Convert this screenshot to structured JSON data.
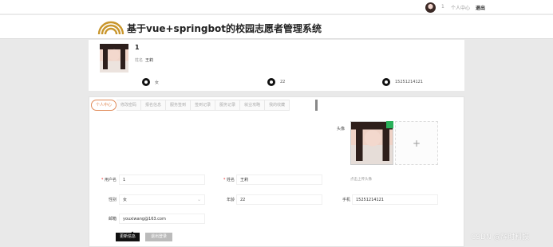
{
  "topbar": {
    "username": "1",
    "personal_center": "个人中心",
    "logout": "退出"
  },
  "header": {
    "site_title": "基于vue+springbot的校园志愿者管理系统"
  },
  "profile": {
    "id": "1",
    "name_label": "姓名",
    "name": "王莉",
    "gender": "女",
    "age": "22",
    "phone": "15251214121"
  },
  "tabs": [
    "个人中心",
    "修改密码",
    "报名信息",
    "服务签到",
    "签到记录",
    "服务记录",
    "就业攻略",
    "我的收藏"
  ],
  "form": {
    "username_label": "用户名",
    "username": "1",
    "name_label": "姓名",
    "name": "王莉",
    "avatar_label": "头像",
    "upload_hint": "点击上传头像",
    "gender_label": "性别",
    "gender": "女",
    "age_label": "年龄",
    "age": "22",
    "phone_label": "手机",
    "phone": "15251214121",
    "email_label": "邮箱",
    "email": "youxiwang@163.com",
    "upload_plus": "+"
  },
  "buttons": {
    "update": "更新信息",
    "logout": "退出登录"
  },
  "watermark": "CSDN @辉时科技"
}
